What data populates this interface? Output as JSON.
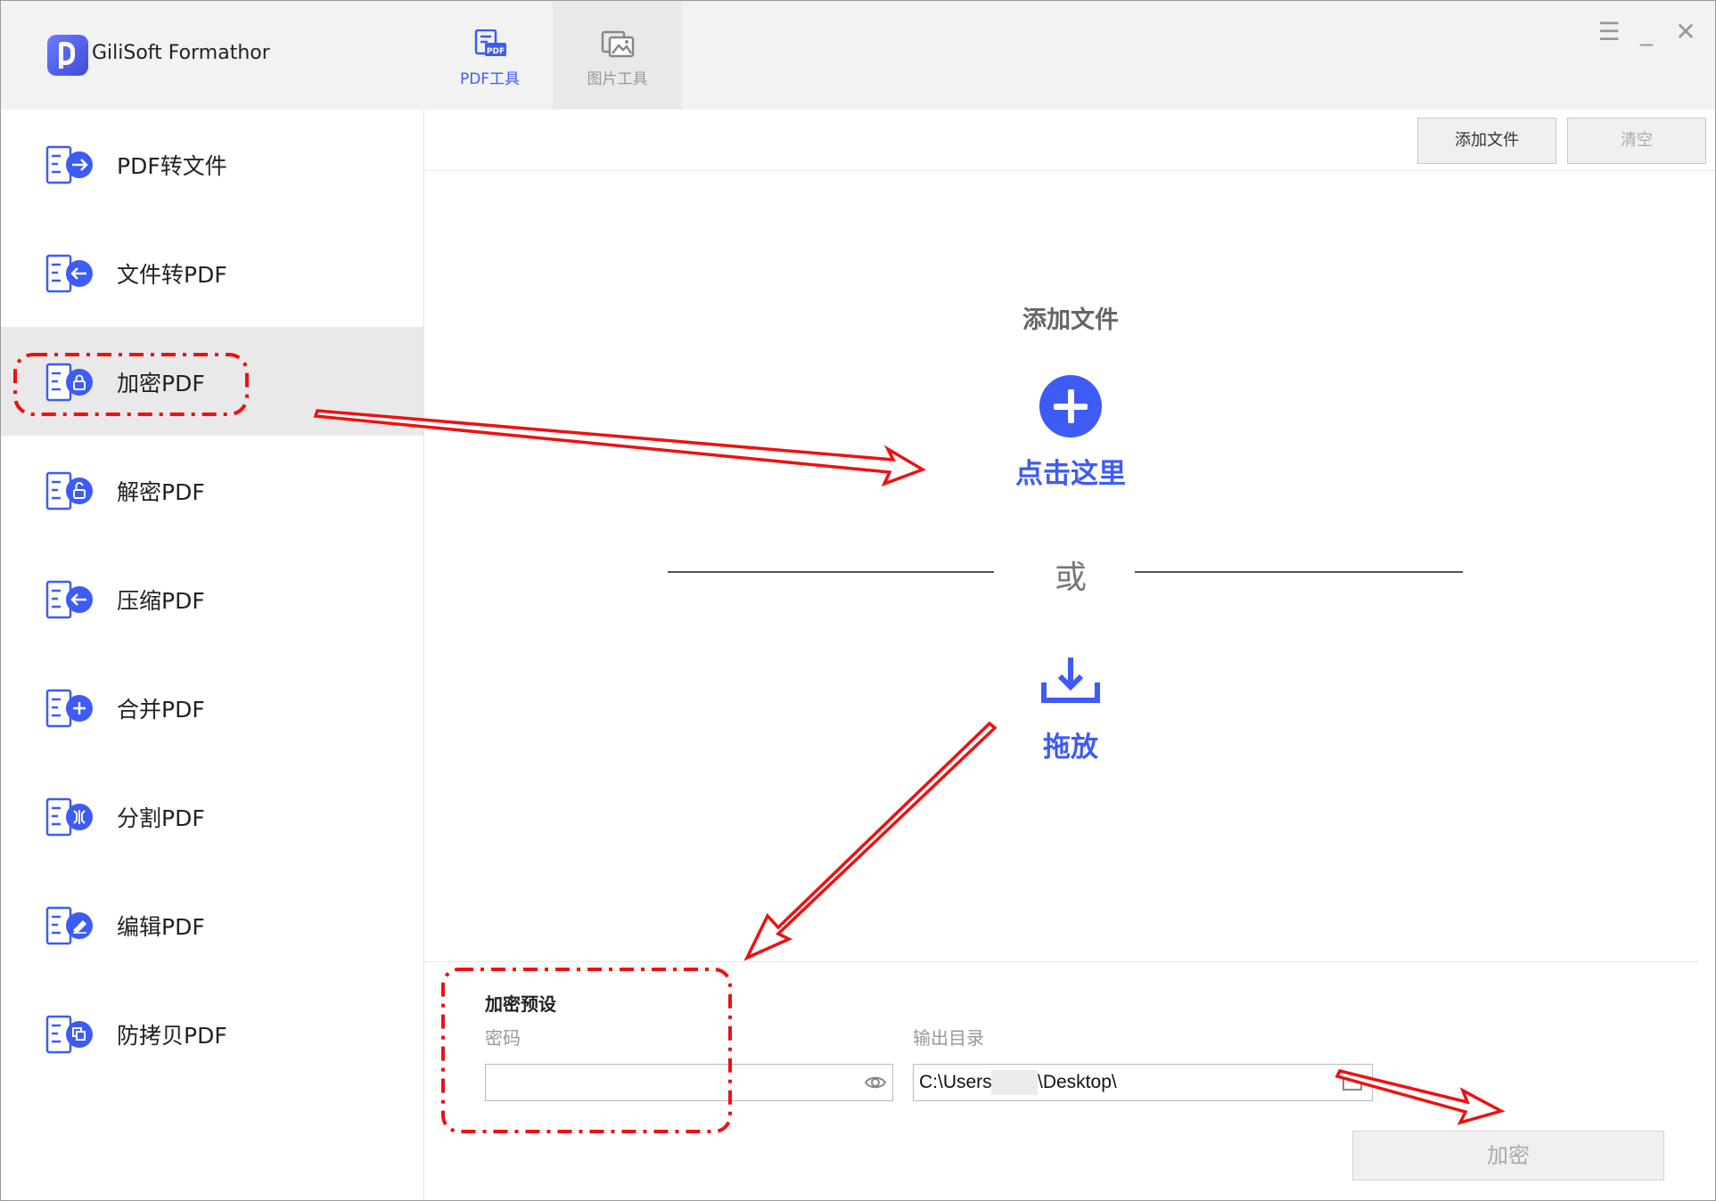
{
  "app": {
    "title": "GiliSoft Formathor"
  },
  "tabs": [
    {
      "label": "PDF工具",
      "icon": "pdf-file-icon",
      "active": true
    },
    {
      "label": "图片工具",
      "icon": "image-file-icon",
      "active": false
    }
  ],
  "window_controls": {
    "menu": "☰",
    "minimize": "_",
    "close": "✕"
  },
  "sidebar": {
    "items": [
      {
        "label": "PDF转文件",
        "icon": "pdf-to-file-icon",
        "active": false
      },
      {
        "label": "文件转PDF",
        "icon": "file-to-pdf-icon",
        "active": false
      },
      {
        "label": "加密PDF",
        "icon": "lock-icon",
        "active": true
      },
      {
        "label": "解密PDF",
        "icon": "unlock-icon",
        "active": false
      },
      {
        "label": "压缩PDF",
        "icon": "compress-icon",
        "active": false
      },
      {
        "label": "合并PDF",
        "icon": "merge-plus-icon",
        "active": false
      },
      {
        "label": "分割PDF",
        "icon": "split-icon",
        "active": false
      },
      {
        "label": "编辑PDF",
        "icon": "edit-pencil-icon",
        "active": false
      },
      {
        "label": "防拷贝PDF",
        "icon": "copy-protect-icon",
        "active": false
      }
    ]
  },
  "toolbar": {
    "add_file": "添加文件",
    "clear": "清空"
  },
  "dropzone": {
    "title": "添加文件",
    "click_here": "点击这里",
    "or": "或",
    "drag_drop": "拖放"
  },
  "preset": {
    "title": "加密预设",
    "password_label": "密码",
    "password_value": "",
    "output_label": "输出目录",
    "output_prefix": "C:\\Users",
    "output_suffix": "\\Desktop\\"
  },
  "encrypt_button": "加密",
  "colors": {
    "accent": "#3d5bf5",
    "annotation": "#ee1111",
    "sidebar_active": "#e9e9e9"
  }
}
